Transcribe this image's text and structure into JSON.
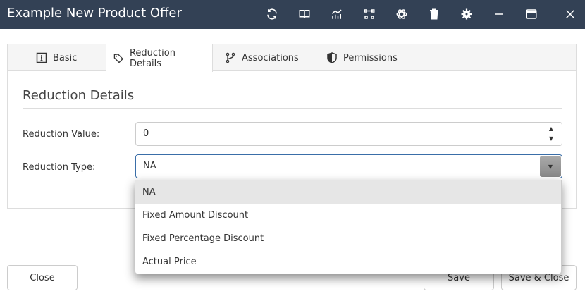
{
  "window": {
    "title": "Example New Product Offer",
    "titlebar_color": "#334155",
    "icons": [
      "refresh-icon",
      "book-icon",
      "chart-icon",
      "diagram-icon",
      "atom-icon",
      "trash-icon",
      "gear-icon",
      "minimize-icon",
      "maximize-icon",
      "close-icon"
    ]
  },
  "tabs": [
    {
      "label": "Basic",
      "icon": "info-icon"
    },
    {
      "label": "Reduction Details",
      "icon": "tag-icon",
      "active": true
    },
    {
      "label": "Associations",
      "icon": "branch-icon"
    },
    {
      "label": "Permissions",
      "icon": "shield-icon"
    }
  ],
  "section": {
    "heading": "Reduction Details"
  },
  "form": {
    "reduction_value": {
      "label": "Reduction Value:",
      "value": "0"
    },
    "reduction_type": {
      "label": "Reduction Type:",
      "value": "NA",
      "options": [
        "NA",
        "Fixed Amount Discount",
        "Fixed Percentage Discount",
        "Actual Price"
      ]
    }
  },
  "buttons": {
    "close": "Close",
    "save": "Save",
    "save_close": "Save & Close"
  },
  "colors": {
    "focus_border": "#3a6ea8",
    "selected_option": "#e6e6e6"
  }
}
